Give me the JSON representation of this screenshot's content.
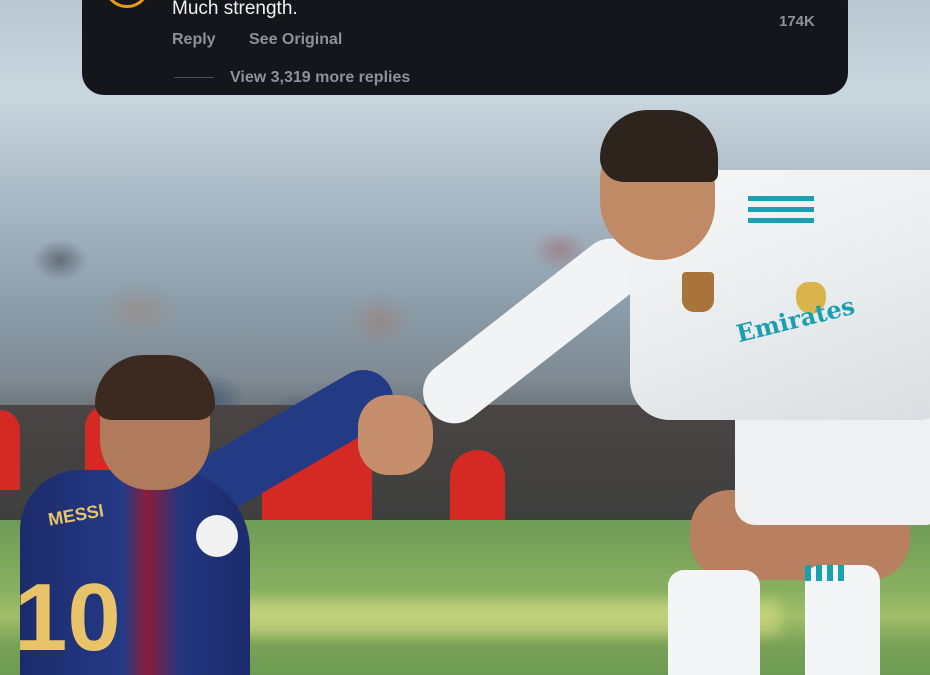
{
  "comment": {
    "text": "Much strength.",
    "reply_label": "Reply",
    "see_original_label": "See Original",
    "like_count": "174K",
    "view_replies_label": "View 3,319 more replies"
  },
  "photo": {
    "left_player_jersey_name": "MESSI",
    "left_player_jersey_number": "10",
    "right_player_sponsor": "Emirates"
  },
  "colors": {
    "card_background": "#14161b",
    "muted_text": "#8e9197",
    "primary_text": "#f1f1f1",
    "avatar_ring": "#e89a1a"
  }
}
